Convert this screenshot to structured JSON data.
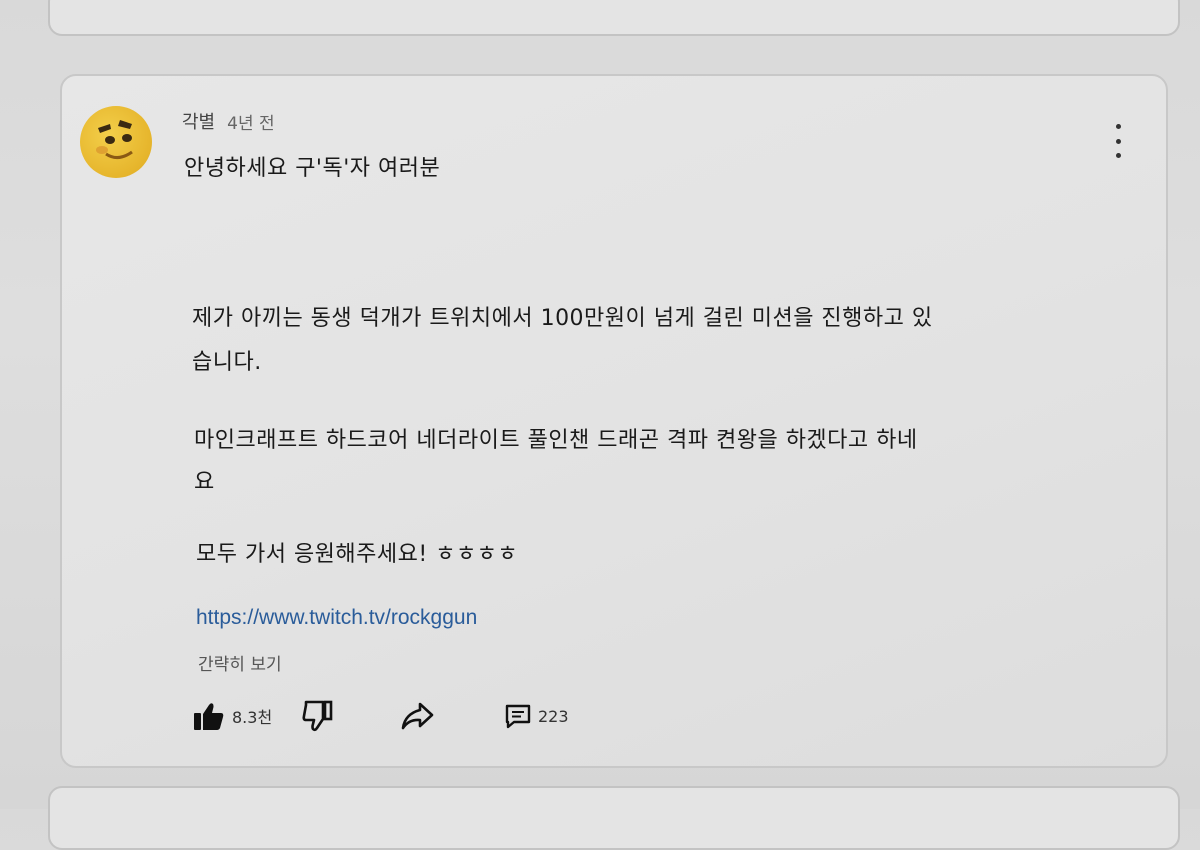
{
  "comment": {
    "author": "각별",
    "time": "4년 전",
    "lines": [
      "안녕하세요 구'독'자 여러분",
      "제가 아끼는 동생 덕개가 트위치에서 100만원이 넘게 걸린 미션을 진행하고 있",
      "습니다.",
      "마인크래프트 하드코어 네더라이트 풀인챈 드래곤 격파 켠왕을 하겠다고 하네",
      "요",
      "모두 가서 응원해주세요! ㅎㅎㅎㅎ"
    ],
    "link": "https://www.twitch.tv/rockggun",
    "collapse_label": "간략히 보기"
  },
  "actions": {
    "like_count": "8.3천",
    "reply_count": "223"
  },
  "icons": {
    "avatar": "cartoon-face-avatar",
    "more": "vertical-dots-icon",
    "like": "thumbs-up-icon",
    "dislike": "thumbs-down-icon",
    "share": "share-arrow-icon",
    "reply": "comment-bubble-icon"
  },
  "colors": {
    "link": "#2a5c9a",
    "avatar": "#e6b52c",
    "card_border": "#c8c8c8"
  }
}
